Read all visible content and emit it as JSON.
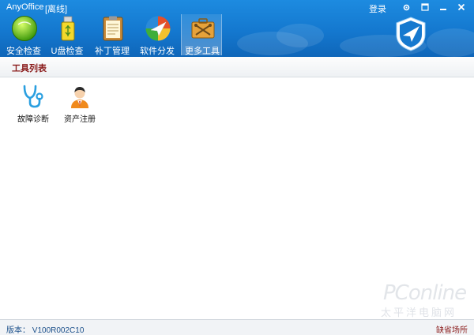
{
  "window": {
    "app_title": "AnyOffice",
    "mode_label": "[离线]",
    "login_label": "登录",
    "controls": {
      "menu_icon": "gear-icon",
      "restore_icon": "restore-icon",
      "minimize_icon": "minimize-icon",
      "close_icon": "close-icon"
    }
  },
  "toolbar": {
    "items": [
      {
        "label": "安全检查",
        "icon": "security-check-icon"
      },
      {
        "label": "U盘检查",
        "icon": "usb-drive-icon"
      },
      {
        "label": "补丁管理",
        "icon": "patch-clipboard-icon"
      },
      {
        "label": "软件分发",
        "icon": "software-distribution-icon"
      },
      {
        "label": "更多工具",
        "icon": "toolbox-icon",
        "active": true
      }
    ]
  },
  "section": {
    "title": "工具列表"
  },
  "tools": [
    {
      "label": "故障诊断",
      "icon": "stethoscope-icon"
    },
    {
      "label": "资产注册",
      "icon": "user-register-icon"
    }
  ],
  "status": {
    "version": "版本： V100R002C10",
    "place": "缺省场所"
  },
  "watermark": {
    "main": "PConline",
    "sub": "太平洋电脑网"
  },
  "colors": {
    "header_blue": "#1478cf",
    "accent_red": "#8a1b1b"
  }
}
